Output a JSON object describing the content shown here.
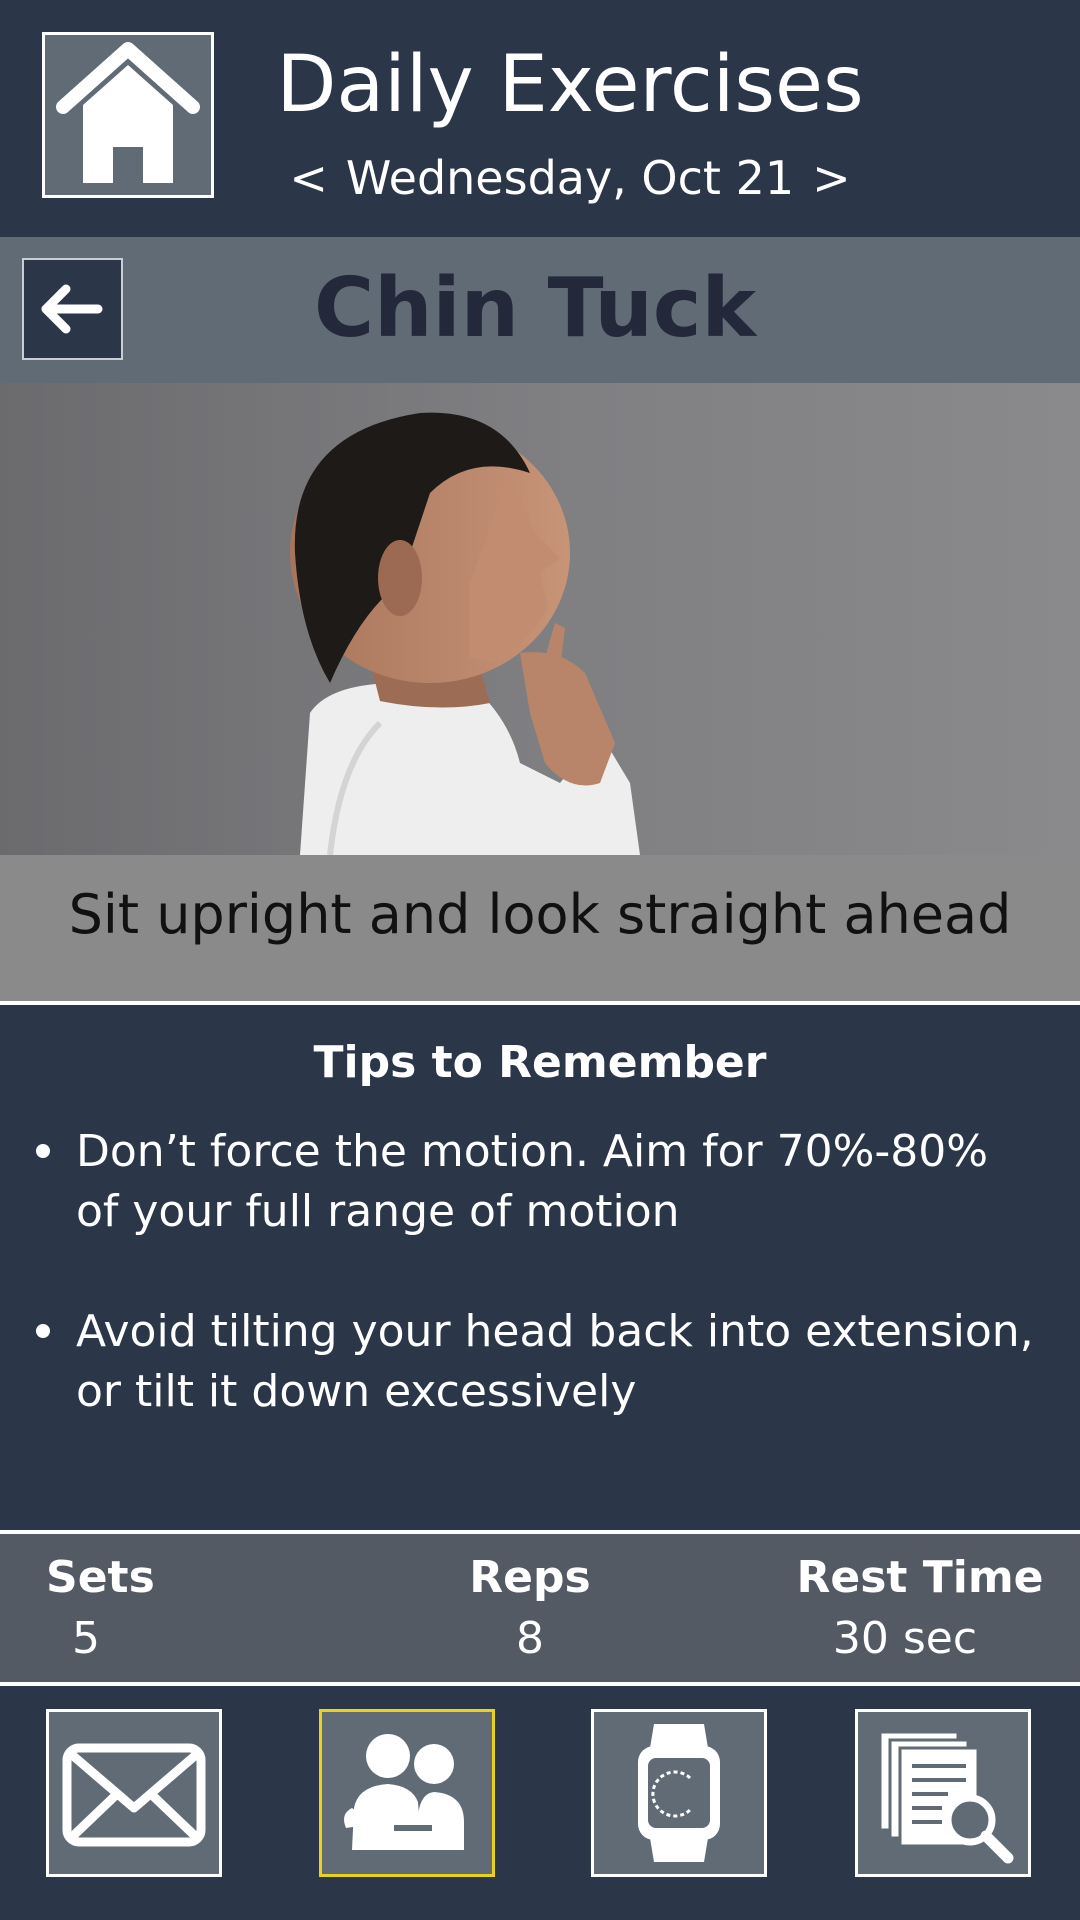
{
  "header": {
    "title": "Daily Exercises",
    "date_prev": "<",
    "date": "Wednesday, Oct 21",
    "date_next": ">",
    "home_icon": "home-icon"
  },
  "exercise": {
    "back_icon": "arrow-left-icon",
    "title": "Chin Tuck",
    "instruction": "Sit upright and look straight ahead"
  },
  "tips": {
    "heading": "Tips to Remember",
    "items": [
      "Don’t force the motion. Aim for 70%-80% of your full range of motion",
      "Avoid tilting your head back into extension, or tilt it down excessively"
    ]
  },
  "stats": {
    "sets_label": "Sets",
    "sets_value": "5",
    "reps_label": "Reps",
    "reps_value": "8",
    "rest_label": "Rest Time",
    "rest_value": "30 sec"
  },
  "nav": {
    "items": [
      {
        "icon": "envelope-icon",
        "selected": false
      },
      {
        "icon": "people-icon",
        "selected": true
      },
      {
        "icon": "smartwatch-icon",
        "selected": false
      },
      {
        "icon": "document-search-icon",
        "selected": false
      }
    ],
    "selected_color": "#e8d21a"
  },
  "colors": {
    "background": "#2c3649",
    "bar": "#606b76",
    "instruction_bg": "#8a8a8a",
    "stats_bg": "#545a64"
  }
}
